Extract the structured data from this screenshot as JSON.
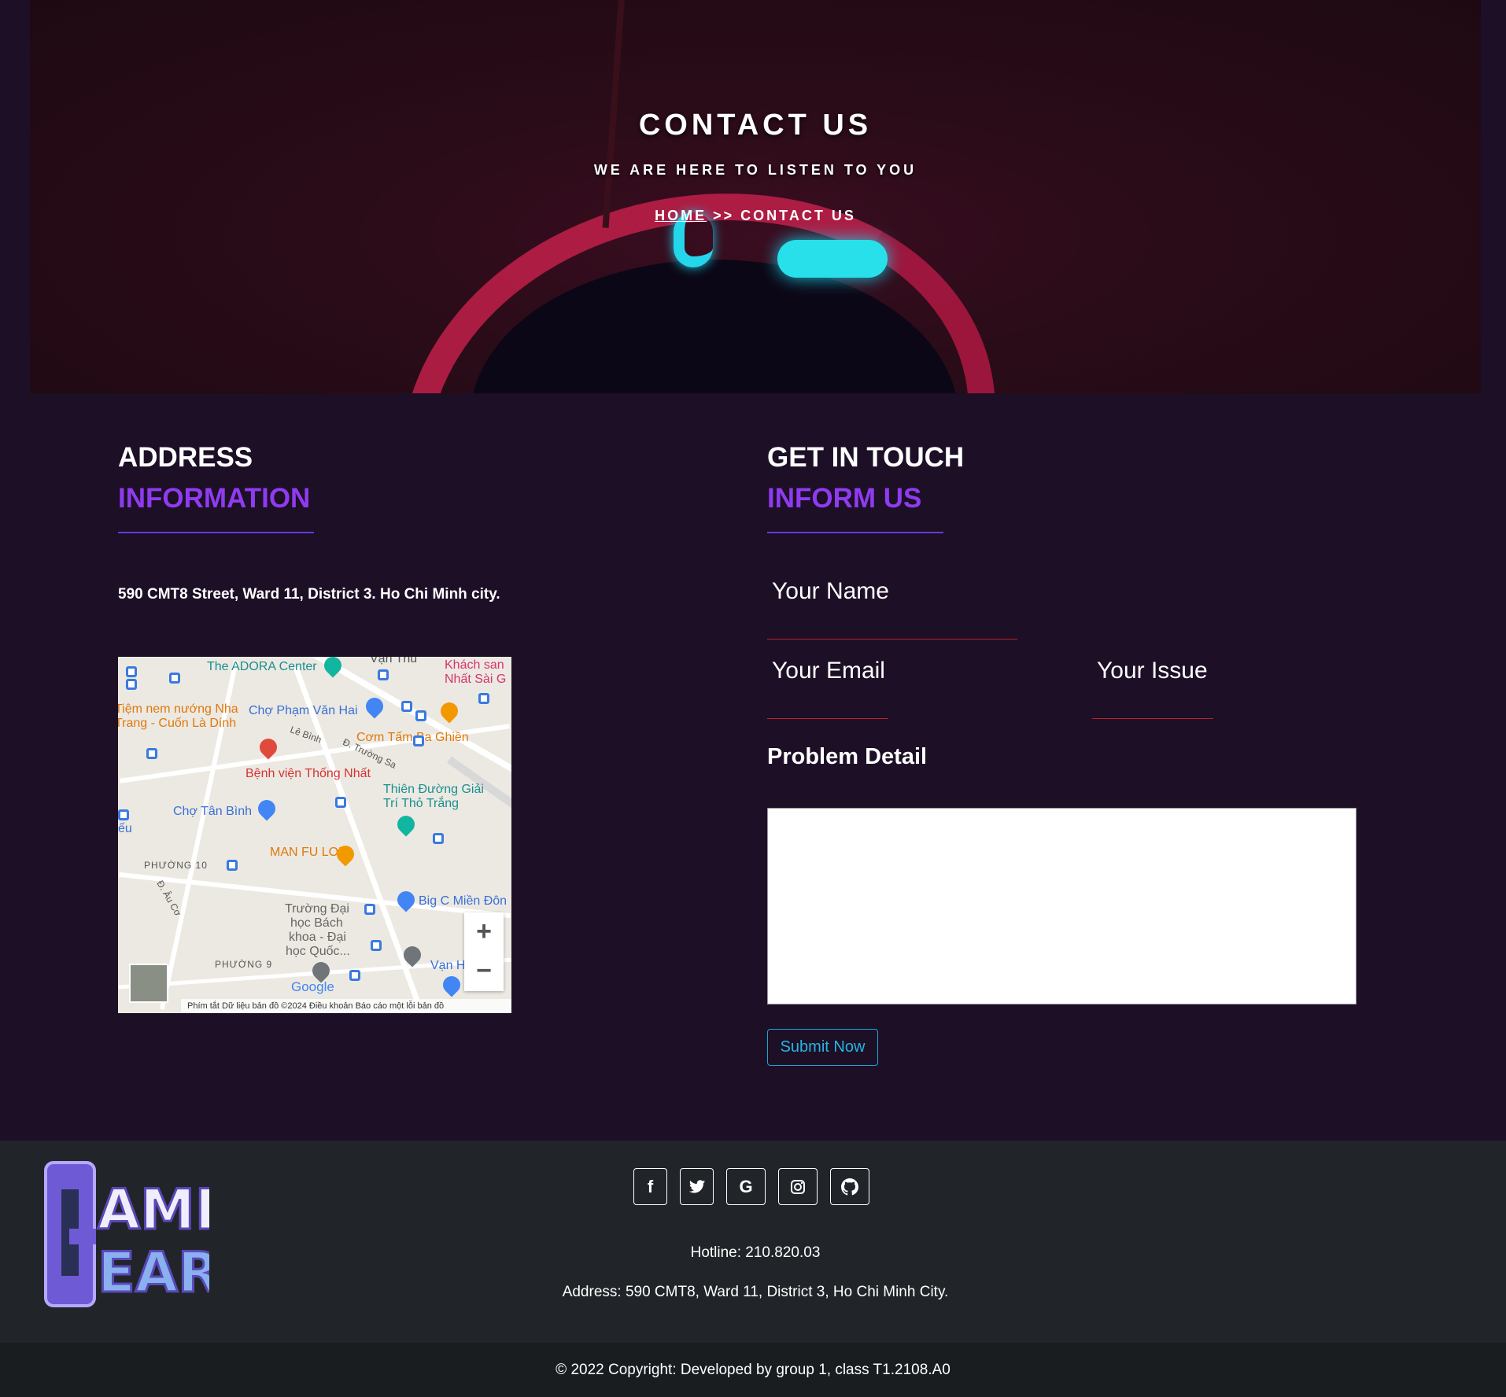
{
  "hero": {
    "title": "CONTACT US",
    "subtitle": "WE ARE HERE TO LISTEN TO YOU",
    "breadcrumb_home": "HOME",
    "breadcrumb_sep": " >> ",
    "breadcrumb_current": "CONTACT US"
  },
  "address_section": {
    "title_line1": "ADDRESS",
    "title_line2": "INFORMATION",
    "address": "590 CMT8 Street, Ward 11, District 3. Ho Chi Minh city."
  },
  "map": {
    "labels": {
      "adora": "The ADORA Center",
      "vanthu": "Vạn Thủ",
      "khachsan1": "Khách san",
      "khachsan2": "Nhất Sài G",
      "nemnuong1": "Tiệm nem nướng Nha",
      "nemnuong2": "Trang - Cuốn Là Dính",
      "chophamvanhai": "Chợ Phạm Văn Hai",
      "lebinh": "Lê Bình",
      "comtam": "Cơm Tấm Ba Ghiền",
      "truongsa": "Đ. Trường Sa",
      "benhvien": "Bệnh viện Thống Nhất",
      "thienduong1": "Thiên Đường Giải",
      "thienduong2": "Trí Thỏ Trắng",
      "chotanbinh": "Chợ Tân Bình",
      "eu": "ếu",
      "manfu": "MAN FU LOU",
      "phuong10": "PHƯỜNG 10",
      "auco": "Đ. Âu Cơ",
      "bigc": "Big C Miền Đôn",
      "bachkhoa1": "Trường Đại",
      "bachkhoa2": "học Bách",
      "bachkhoa3": "khoa - Đại",
      "bachkhoa4": "học Quốc...",
      "phuong9": "PHƯỜNG 9",
      "van": "Vạn H",
      "google": "Google",
      "zoom_in": "+",
      "zoom_out": "−"
    },
    "attribution": "Phím tắt    Dữ liệu bản đồ ©2024    Điều khoản    Báo cáo một lỗi bản đồ"
  },
  "contact_section": {
    "title_line1": "GET IN TOUCH",
    "title_line2": "INFORM US",
    "name_label": "Your Name",
    "email_label": "Your Email",
    "issue_label": "Your Issue",
    "problem_label": "Problem Detail",
    "problem_value": "",
    "submit_label": "Submit Now"
  },
  "footer": {
    "logo_alt": "GAME GEAR",
    "socials": [
      "facebook-icon",
      "twitter-icon",
      "google-icon",
      "instagram-icon",
      "github-icon"
    ],
    "hotline": "Hotline: 210.820.03",
    "address": "Address: 590 CMT8, Ward 11, District 3, Ho Chi Minh City.",
    "copyright": "© 2022 Copyright: Developed by group 1, class T1.2108.A0"
  },
  "colors": {
    "background": "#1c0f26",
    "accent_purple": "#8f3bf0",
    "underline_red": "#b8222e",
    "submit_blue": "#26b6e0",
    "footer_bg": "#212529"
  }
}
